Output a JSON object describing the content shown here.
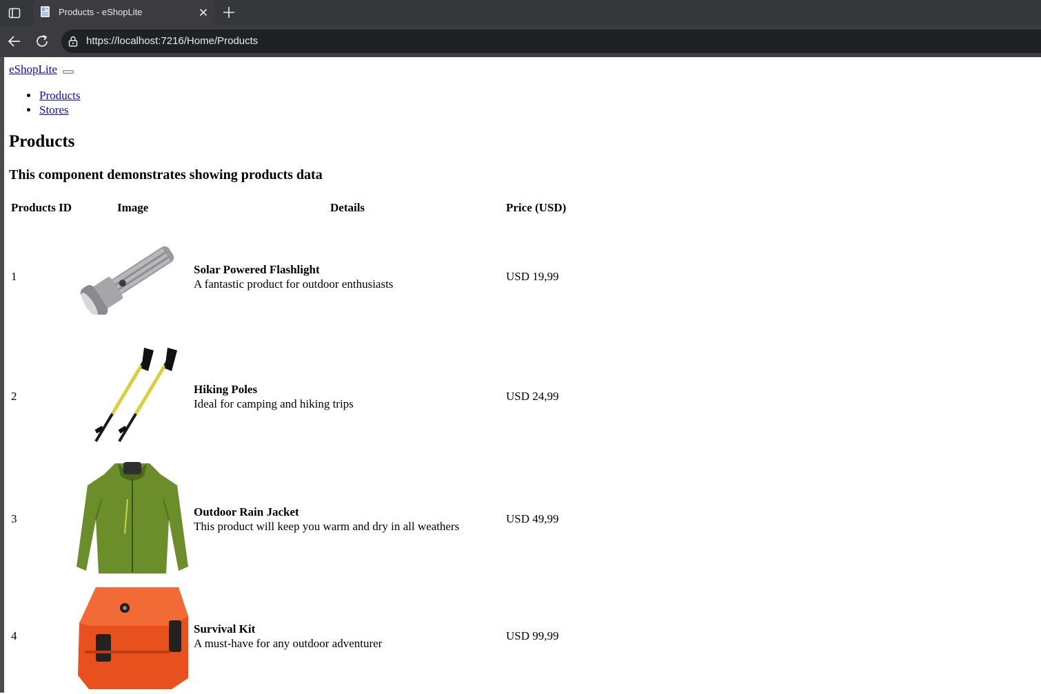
{
  "browser": {
    "tab_title": "Products - eShopLite",
    "url": "https://localhost:7216/Home/Products"
  },
  "site": {
    "brand": "eShopLite",
    "nav": [
      {
        "label": "Products"
      },
      {
        "label": "Stores"
      }
    ]
  },
  "page": {
    "title": "Products",
    "subtitle": "This component demonstrates showing products data"
  },
  "table": {
    "columns": [
      "Products ID",
      "Image",
      "Details",
      "Price (USD)"
    ],
    "rows": [
      {
        "id": "1",
        "name": "Solar Powered Flashlight",
        "description": "A fantastic product for outdoor enthusiasts",
        "price": "USD 19,99",
        "image_icon": "flashlight-image"
      },
      {
        "id": "2",
        "name": "Hiking Poles",
        "description": "Ideal for camping and hiking trips",
        "price": "USD 24,99",
        "image_icon": "hiking-poles-image"
      },
      {
        "id": "3",
        "name": "Outdoor Rain Jacket",
        "description": "This product will keep you warm and dry in all weathers",
        "price": "USD 49,99",
        "image_icon": "rain-jacket-image"
      },
      {
        "id": "4",
        "name": "Survival Kit",
        "description": "A must-have for any outdoor adventurer",
        "price": "USD 99,99",
        "image_icon": "survival-kit-image"
      }
    ]
  },
  "colors": {
    "chrome_dark": "#36373b",
    "link": "#0b0bd6",
    "jacket_green": "#6b8e2a",
    "kit_orange": "#e8501e"
  }
}
